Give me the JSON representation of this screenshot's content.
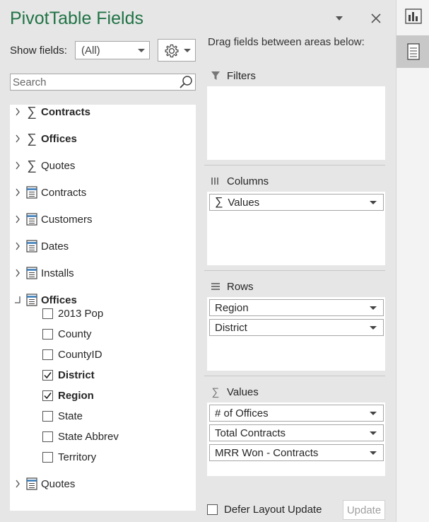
{
  "panel": {
    "title": "PivotTable Fields",
    "accent": "#217346",
    "show_fields_label": "Show fields:",
    "show_fields_value": "(All)",
    "search_placeholder": "Search"
  },
  "fields": [
    {
      "type": "measure",
      "label": "Contracts",
      "bold": true
    },
    {
      "type": "measure",
      "label": "Offices",
      "bold": true
    },
    {
      "type": "measure",
      "label": "Quotes",
      "bold": false
    },
    {
      "type": "table",
      "label": "Contracts",
      "bold": false
    },
    {
      "type": "table",
      "label": "Customers",
      "bold": false
    },
    {
      "type": "table",
      "label": "Dates",
      "bold": false
    },
    {
      "type": "table",
      "label": "Installs",
      "bold": false
    },
    {
      "type": "table",
      "label": "Offices",
      "bold": true,
      "expanded": true,
      "children": [
        {
          "label": "2013 Pop",
          "checked": false
        },
        {
          "label": "County",
          "checked": false
        },
        {
          "label": "CountyID",
          "checked": false
        },
        {
          "label": "District",
          "checked": true
        },
        {
          "label": "Region",
          "checked": true
        },
        {
          "label": "State",
          "checked": false
        },
        {
          "label": "State Abbrev",
          "checked": false
        },
        {
          "label": "Territory",
          "checked": false
        }
      ]
    },
    {
      "type": "table",
      "label": "Quotes",
      "bold": false
    }
  ],
  "areas": {
    "drag_label": "Drag fields between areas below:",
    "filters": {
      "label": "Filters",
      "items": []
    },
    "columns": {
      "label": "Columns",
      "items": [
        "Values"
      ]
    },
    "rows": {
      "label": "Rows",
      "items": [
        "Region",
        "District"
      ]
    },
    "values": {
      "label": "Values",
      "items": [
        "# of Offices",
        "Total Contracts",
        "MRR Won - Contracts"
      ]
    }
  },
  "footer": {
    "defer_label": "Defer Layout Update",
    "update_label": "Update"
  }
}
